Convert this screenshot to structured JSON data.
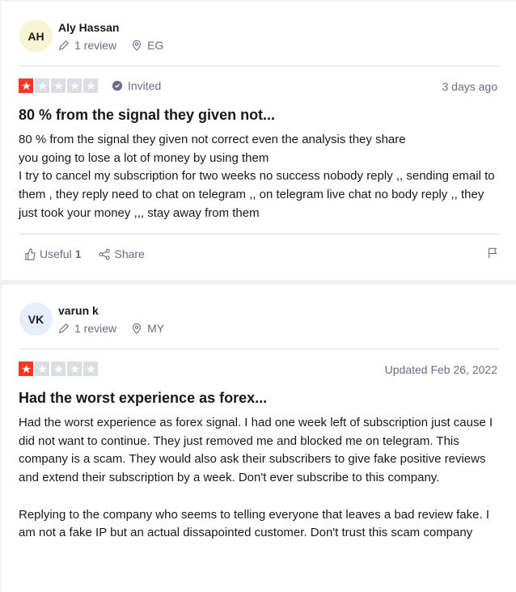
{
  "colors": {
    "star_filled": "#ff3722",
    "star_empty": "#dcdce6",
    "muted": "#6b6b83"
  },
  "reviews": [
    {
      "initials": "AH",
      "avatar_color": "#f8f5d7",
      "name": "Aly Hassan",
      "review_count": "1 review",
      "country": "EG",
      "rating": 1,
      "badge": "Invited",
      "date": "3 days ago",
      "title": "80 % from the signal they given not...",
      "body": "80 % from the signal they given not correct even the analysis they share\nyou going to lose a lot of money by using them\nI try to cancel my subscription for two weeks no success nobody reply ,, sending email to them , they reply need to chat on telegram ,, on telegram live chat no body reply ,, they just took your money ,,, stay away from them",
      "useful_label": "Useful",
      "useful_count": "1",
      "share_label": "Share"
    },
    {
      "initials": "VK",
      "avatar_color": "#e5eefa",
      "name": "varun k",
      "review_count": "1 review",
      "country": "MY",
      "rating": 1,
      "date": "Updated Feb 26, 2022",
      "title": "Had the worst experience as forex...",
      "body": "Had the worst experience as forex signal. I had one week left of subscription just cause I did not want to continue. They just removed me and blocked me on telegram. This company is a scam. They would also ask their subscribers to give fake positive reviews and extend their subscription by a week. Don't ever subscribe to this company.\n\nReplying to the company who seems to telling everyone that leaves a bad review fake. I am not a fake IP but an actual dissapointed customer. Don't trust this scam company"
    }
  ]
}
